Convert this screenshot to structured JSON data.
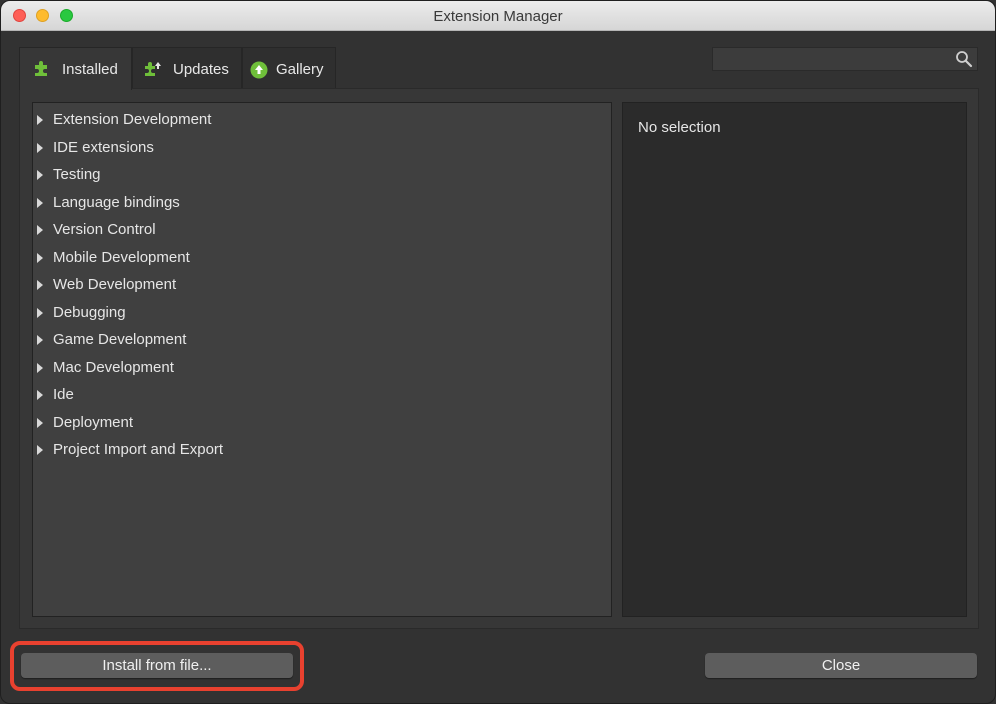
{
  "window": {
    "title": "Extension Manager"
  },
  "tabs": [
    {
      "label": "Installed",
      "icon": "puzzle-icon",
      "active": true
    },
    {
      "label": "Updates",
      "icon": "puzzle-update-icon",
      "active": false
    },
    {
      "label": "Gallery",
      "icon": "upload-circle-icon",
      "active": false
    }
  ],
  "search": {
    "value": "",
    "icon": "magnifier-icon"
  },
  "categories": [
    "Extension Development",
    "IDE extensions",
    "Testing",
    "Language bindings",
    "Version Control",
    "Mobile Development",
    "Web Development",
    "Debugging",
    "Game Development",
    "Mac Development",
    "Ide",
    "Deployment",
    "Project Import and Export"
  ],
  "detail": {
    "empty_text": "No selection"
  },
  "buttons": {
    "install": "Install from file...",
    "close": "Close"
  },
  "colors": {
    "accent_green": "#6fbf3a",
    "highlight_red": "#e8412f",
    "window_bg": "#323232"
  }
}
